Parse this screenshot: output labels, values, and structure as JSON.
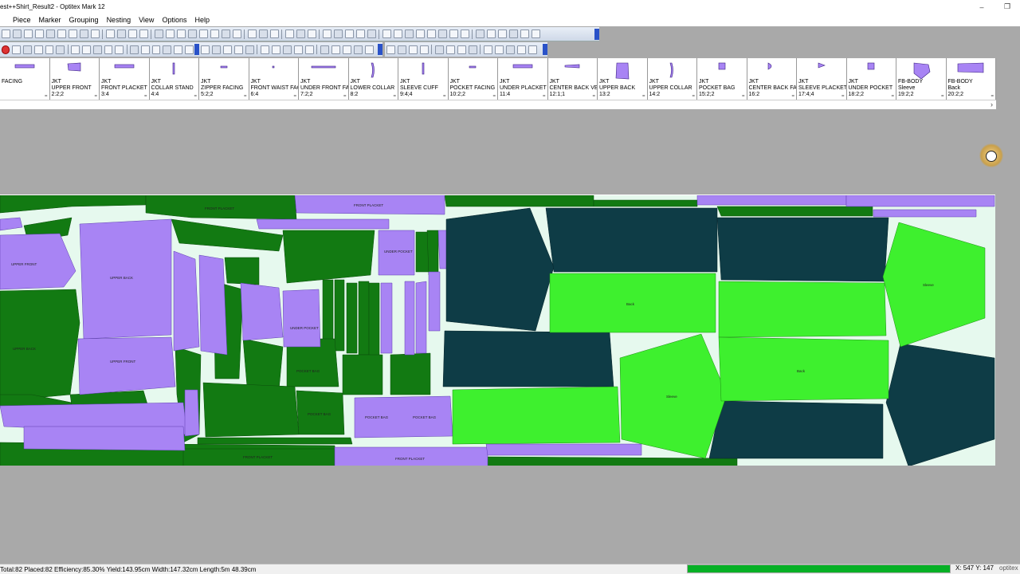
{
  "window": {
    "title": "est++Shirt_Result2 - Optitex Mark 12",
    "minimize": "–",
    "restore": "❐"
  },
  "menu": [
    "Piece",
    "Marker",
    "Grouping",
    "Nesting",
    "View",
    "Options",
    "Help"
  ],
  "colors": {
    "purple": "#a884f4",
    "dark_green": "#127a12",
    "bright_green": "#3ef02e",
    "dark_teal": "#0e3c46",
    "marker_bg": "#e6f9ee",
    "status_green": "#06b025"
  },
  "pieces": [
    {
      "l1": "FACING",
      "l2": "",
      "l3": "",
      "thumb": "bar"
    },
    {
      "l1": "JKT",
      "l2": "UPPER FRONT",
      "l3": "2:2;2",
      "thumb": "block"
    },
    {
      "l1": "JKT",
      "l2": "FRONT PLACKET",
      "l3": "3:4",
      "thumb": "bar"
    },
    {
      "l1": "JKT",
      "l2": "COLLAR STAND",
      "l3": "4:4",
      "thumb": "vline"
    },
    {
      "l1": "JKT",
      "l2": "ZIPPER FACING",
      "l3": "5:2;2",
      "thumb": "dash"
    },
    {
      "l1": "JKT",
      "l2": "FRONT WAIST FAC",
      "l3": "6:4",
      "thumb": "dot"
    },
    {
      "l1": "JKT",
      "l2": "UNDER FRONT FAC",
      "l3": "7:2;2",
      "thumb": "hline"
    },
    {
      "l1": "JKT",
      "l2": "LOWER COLLAR",
      "l3": "8:2",
      "thumb": "curve"
    },
    {
      "l1": "JKT",
      "l2": "SLEEVE CUFF",
      "l3": "9:4;4",
      "thumb": "vline"
    },
    {
      "l1": "JKT",
      "l2": "POCKET FACING",
      "l3": "10:2;2",
      "thumb": "dash"
    },
    {
      "l1": "JKT",
      "l2": "UNDER PLACKET",
      "l3": "11:4",
      "thumb": "bar"
    },
    {
      "l1": "JKT",
      "l2": "CENTER BACK VEN",
      "l3": "12:1;1",
      "thumb": "flag"
    },
    {
      "l1": "JKT",
      "l2": "UPPER BACK",
      "l3": "13:2",
      "thumb": "tall"
    },
    {
      "l1": "JKT",
      "l2": "UPPER COLLAR",
      "l3": "14:2",
      "thumb": "curve"
    },
    {
      "l1": "JKT",
      "l2": "POCKET BAG",
      "l3": "15:2;2",
      "thumb": "small"
    },
    {
      "l1": "JKT",
      "l2": "CENTER BACK FAC",
      "l3": "16:2",
      "thumb": "half"
    },
    {
      "l1": "JKT",
      "l2": "SLEEVE PLACKET",
      "l3": "17:4;4",
      "thumb": "tri"
    },
    {
      "l1": "JKT",
      "l2": "UNDER POCKET",
      "l3": "18:2;2",
      "thumb": "small"
    },
    {
      "l1": "FB-BODY",
      "l2": "Sleeve",
      "l3": "19:2;2",
      "thumb": "sleeve"
    },
    {
      "l1": "FB-BODY",
      "l2": "Back",
      "l3": "20:2;2",
      "thumb": "wide"
    }
  ],
  "marker_labels": {
    "upper_front": "UPPER FRONT",
    "upper_back": "UPPER BACK",
    "front_placket": "FRONT PLACKET",
    "under_pocket": "UNDER POCKET",
    "pocket_bag": "POCKET BAG",
    "sleeve": "Sleeve",
    "back": "Back"
  },
  "status": {
    "text": "Total:82  Placed:82  Efficiency:85.30%  Yield:143.95cm  Width:147.32cm  Length:5m 48.39cm",
    "progress": 1.0,
    "coords": "X: 547  Y: 147",
    "brand": "optitex"
  }
}
